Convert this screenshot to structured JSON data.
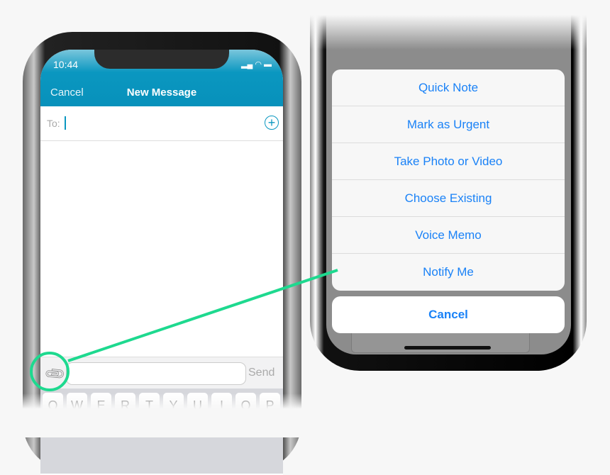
{
  "left_phone": {
    "status_time": "10:44",
    "nav": {
      "cancel_label": "Cancel",
      "title": "New Message"
    },
    "to_label": "To:",
    "input": {
      "value": "",
      "placeholder": ""
    },
    "send_label": "Send",
    "keys": [
      "Q",
      "W",
      "E",
      "R",
      "T",
      "Y",
      "U",
      "I",
      "O",
      "P"
    ]
  },
  "right_phone": {
    "options": [
      "Quick Note",
      "Mark as Urgent",
      "Take Photo or Video",
      "Choose Existing",
      "Voice Memo",
      "Notify Me"
    ],
    "cancel_label": "Cancel"
  },
  "colors": {
    "header": "#0a97c0",
    "action_blue": "#1a82f7",
    "highlight": "#1ed98f"
  }
}
